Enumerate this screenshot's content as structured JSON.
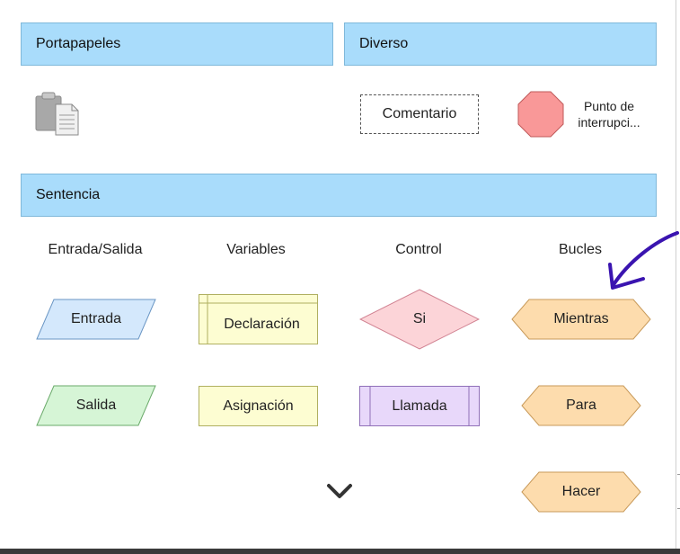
{
  "sections": {
    "clipboard": "Portapapeles",
    "misc": "Diverso",
    "statement": "Sentencia"
  },
  "misc_items": {
    "comment": "Comentario",
    "breakpoint": "Punto de interrupci..."
  },
  "columns": {
    "io": "Entrada/Salida",
    "variables": "Variables",
    "control": "Control",
    "loops": "Bucles"
  },
  "blocks": {
    "input": "Entrada",
    "output": "Salida",
    "declaration": "Declaración",
    "assignment": "Asignación",
    "if": "Si",
    "call": "Llamada",
    "while": "Mientras",
    "for": "Para",
    "do": "Hacer"
  },
  "icons": {
    "clipboard": "clipboard-paste-icon",
    "expand": "chevron-down-icon",
    "annotation": "hand-drawn-arrow"
  },
  "colors": {
    "header": "#a9dcfb",
    "io_input": "#d4e8fc",
    "io_output": "#d6f5d6",
    "variables": "#fdfdd2",
    "control_if": "#fcd4d8",
    "control_call": "#e8d8fa",
    "loops": "#fddcad",
    "breakpoint": "#f99898",
    "annotation": "#3a14b0"
  }
}
